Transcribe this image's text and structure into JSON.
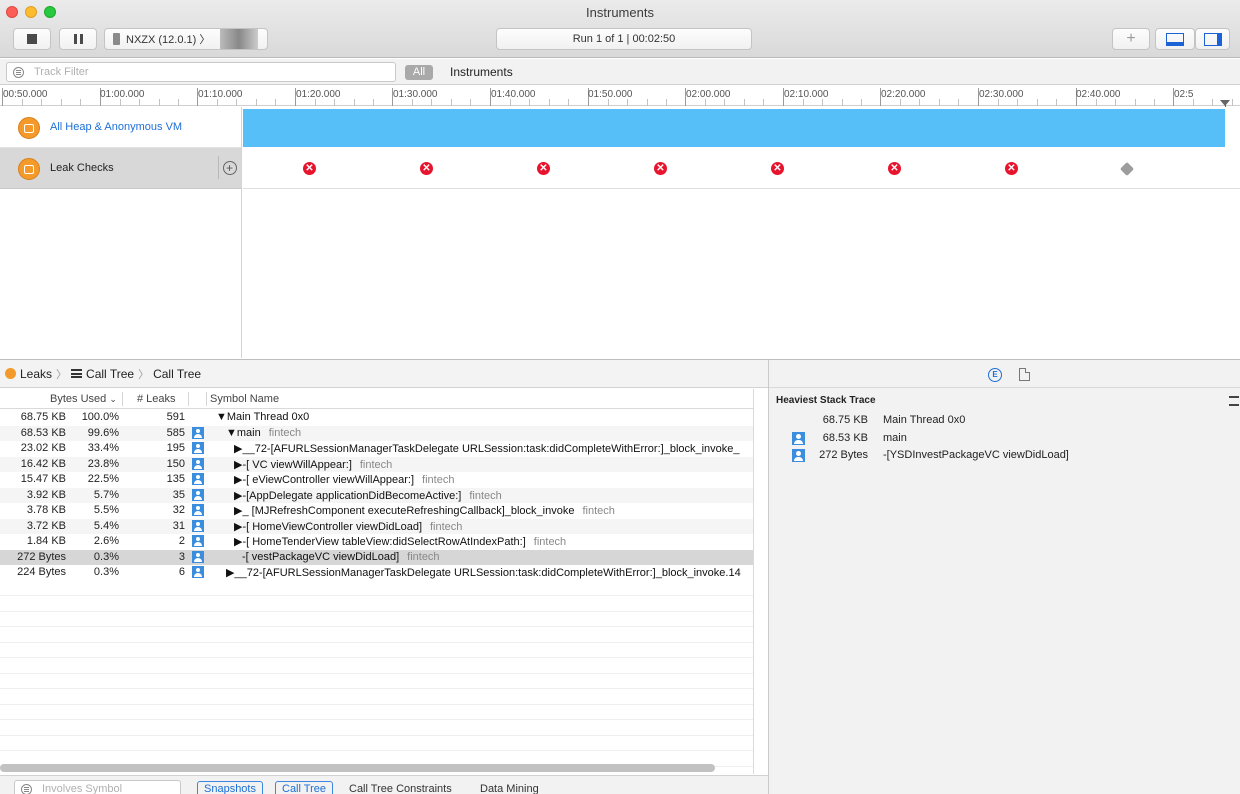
{
  "window": {
    "title": "Instruments"
  },
  "toolbar": {
    "device_label": "NXZX (12.0.1) 〉",
    "run_status": "Run 1 of 1  |  00:02:50"
  },
  "filter": {
    "track_filter_placeholder": "Track Filter",
    "all_label": "All",
    "scope_label": "Instruments"
  },
  "timeline": {
    "labels": [
      "00:50.000",
      "01:00.000",
      "01:10.000",
      "01:20.000",
      "01:30.000",
      "01:40.000",
      "01:50.000",
      "02:00.000",
      "02:10.000",
      "02:20.000",
      "02:30.000",
      "02:40.000",
      "02:5"
    ]
  },
  "tracks": [
    {
      "name": "All Heap & Anonymous VM",
      "icon": "allocations-icon"
    },
    {
      "name": "Leak Checks",
      "icon": "leaks-icon"
    }
  ],
  "breadcrumb": {
    "item1": "Leaks",
    "item2": "Call Tree",
    "item3": "Call Tree"
  },
  "columns": {
    "bytes_used": "Bytes Used",
    "leaks": "# Leaks",
    "symbol": "Symbol Name"
  },
  "call_tree": [
    {
      "bytes": "68.75 KB",
      "pct": "100.0%",
      "leaks": "591",
      "symbol": "▼Main Thread  0x0",
      "lib": "",
      "user": false,
      "indent": 216
    },
    {
      "bytes": "68.53 KB",
      "pct": "99.6%",
      "leaks": "585",
      "symbol": "▼main",
      "lib": "fintech",
      "user": true,
      "indent": 226
    },
    {
      "bytes": "23.02 KB",
      "pct": "33.4%",
      "leaks": "195",
      "symbol": "▶__72-[AFURLSessionManagerTaskDelegate URLSession:task:didCompleteWithError:]_block_invoke_",
      "lib": "",
      "user": true,
      "indent": 234
    },
    {
      "bytes": "16.42 KB",
      "pct": "23.8%",
      "leaks": "150",
      "symbol": "▶-[        VC viewWillAppear:]",
      "lib": "fintech",
      "user": true,
      "indent": 234
    },
    {
      "bytes": "15.47 KB",
      "pct": "22.5%",
      "leaks": "135",
      "symbol": "▶-[       eViewController viewWillAppear:]",
      "lib": "fintech",
      "user": true,
      "indent": 234
    },
    {
      "bytes": "3.92 KB",
      "pct": "5.7%",
      "leaks": "35",
      "symbol": "▶-[AppDelegate applicationDidBecomeActive:]",
      "lib": "fintech",
      "user": true,
      "indent": 234
    },
    {
      "bytes": "3.78 KB",
      "pct": "5.5%",
      "leaks": "32",
      "symbol": "▶_     [MJRefreshComponent executeRefreshingCallback]_block_invoke",
      "lib": "fintech",
      "user": true,
      "indent": 234
    },
    {
      "bytes": "3.72 KB",
      "pct": "5.4%",
      "leaks": "31",
      "symbol": "▶-[      HomeViewController viewDidLoad]",
      "lib": "fintech",
      "user": true,
      "indent": 234
    },
    {
      "bytes": "1.84 KB",
      "pct": "2.6%",
      "leaks": "2",
      "symbol": "▶-[      HomeTenderView tableView:didSelectRowAtIndexPath:]",
      "lib": "fintech",
      "user": true,
      "indent": 234
    },
    {
      "bytes": "272 Bytes",
      "pct": "0.3%",
      "leaks": "3",
      "symbol": "-[      vestPackageVC viewDidLoad]",
      "lib": "fintech",
      "user": true,
      "indent": 242
    },
    {
      "bytes": "224 Bytes",
      "pct": "0.3%",
      "leaks": "6",
      "symbol": "▶__72-[AFURLSessionManagerTaskDelegate URLSession:task:didCompleteWithError:]_block_invoke.14",
      "lib": "",
      "user": true,
      "indent": 226
    }
  ],
  "bottom": {
    "involves_placeholder": "Involves Symbol",
    "tab_snapshots": "Snapshots",
    "tab_call_tree": "Call Tree",
    "tab_constraints": "Call Tree Constraints",
    "tab_data_mining": "Data Mining"
  },
  "inspector": {
    "title": "Heaviest Stack Trace",
    "frames": [
      {
        "size": "68.75 KB",
        "symbol": "Main Thread  0x0",
        "user": false
      },
      {
        "size": "68.53 KB",
        "symbol": "main",
        "user": true
      },
      {
        "size": "272 Bytes",
        "symbol": "-[YSDInvestPackageVC viewDidLoad]",
        "user": true
      }
    ]
  },
  "colors": {
    "heap_bar": "#56bff7",
    "leak_mark": "#e8132c",
    "accent": "#1d6fd6",
    "instrument_icon": "#f39a2b"
  }
}
